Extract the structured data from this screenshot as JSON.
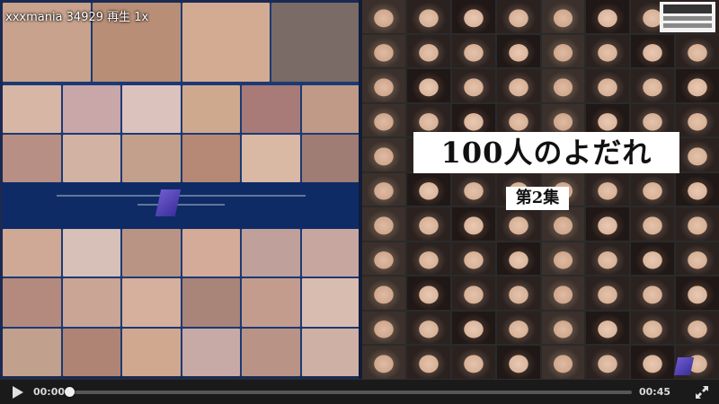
{
  "video": {
    "title": "xxxmania 34929 再生 1x",
    "cover_title": "100人のよだれ",
    "cover_subtitle": "第2集"
  },
  "controls": {
    "play_icon": "play-icon",
    "fullscreen_icon": "fullscreen-icon",
    "current_time": "00:00",
    "duration": "00:45",
    "progress": 0.0
  },
  "colors": {
    "control_bar": "#1a1a1a",
    "cover_blue": "#1b3a74"
  }
}
